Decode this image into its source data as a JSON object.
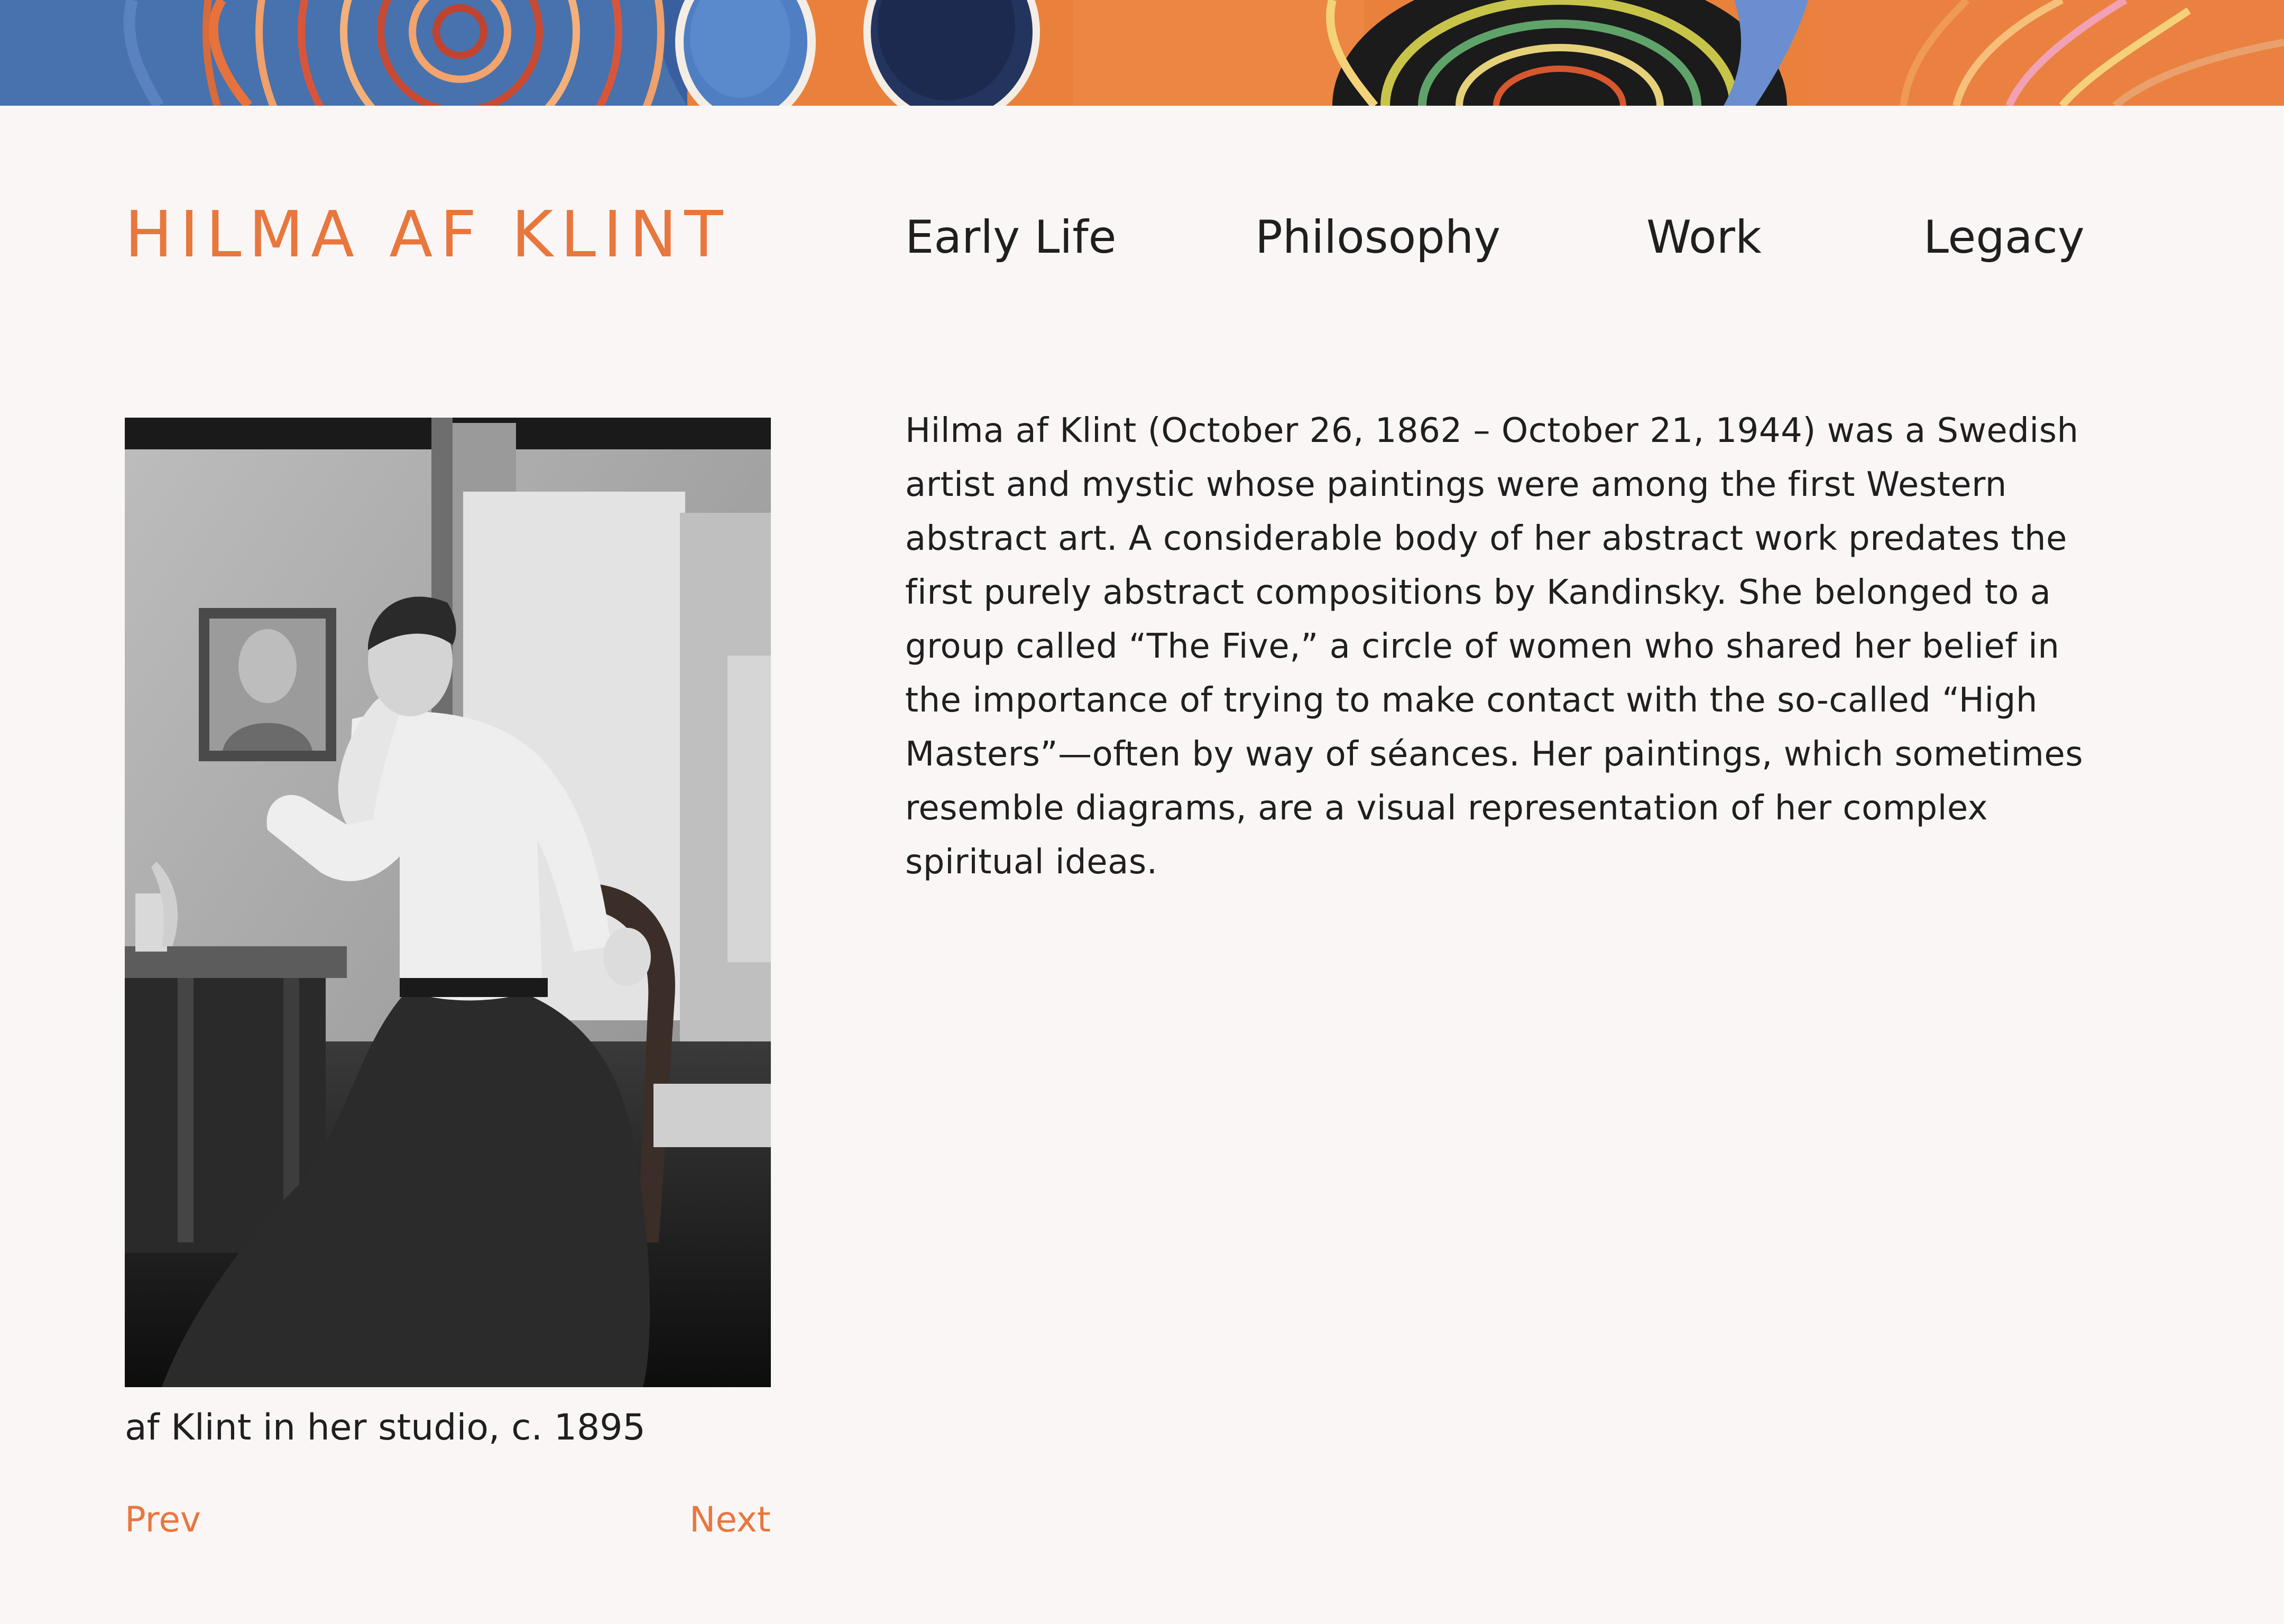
{
  "site": {
    "logo": "HILMA AF KLINT"
  },
  "nav": {
    "items": [
      {
        "label": "Early Life"
      },
      {
        "label": "Philosophy"
      },
      {
        "label": "Work"
      },
      {
        "label": "Legacy"
      }
    ]
  },
  "main": {
    "photo_caption": "af Klint in her studio, c. 1895",
    "pager": {
      "prev": "Prev",
      "next": "Next"
    },
    "bio": "Hilma af Klint (October 26, 1862 – October 21, 1944) was a Swedish artist and mystic whose paintings were among the first Western abstract art. A considerable body of her abstract work predates the first purely abstract compositions by Kandinsky. She belonged to a group called “The Five,” a circle of women who shared her belief in the importance of trying to make contact with the so-called “High Masters”—often by way of séances. Her paintings, which sometimes resemble diagrams, are a visual representation of her complex spiritual ideas."
  },
  "colors": {
    "accent": "#e8773e",
    "background": "#fbf6f6",
    "text": "#1f1f1f"
  }
}
